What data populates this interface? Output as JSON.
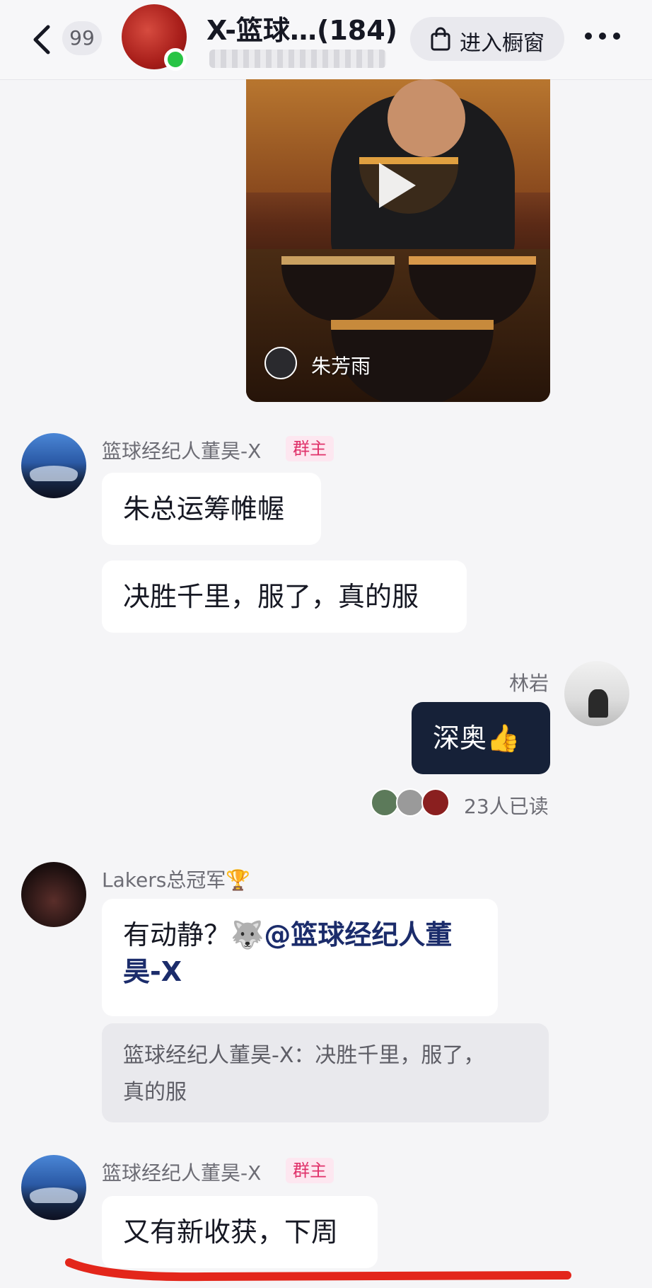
{
  "header": {
    "back_badge": "99",
    "title": "X-篮球…(184)",
    "shop_label": "进入橱窗",
    "colors": {
      "online": "#28c445",
      "background": "#f7f7f9"
    }
  },
  "video": {
    "author": "朱芳雨"
  },
  "messages": [
    {
      "sender": "篮球经纪人董昊-X",
      "role_tag": "群主",
      "bubbles": [
        "朱总运筹帷幄",
        "决胜千里，服了，真的服"
      ]
    },
    {
      "sender": "林岩",
      "text": "深奥",
      "emoji": "👍",
      "read_count": "23人已读"
    },
    {
      "sender": "Lakers总冠军",
      "sender_emoji": "🏆",
      "text_prefix": "有动静？",
      "emoji": "🐺",
      "mention_line1": "@篮球经纪人董",
      "mention_line2": "昊-X",
      "quote_line1": "篮球经纪人董昊-X：决胜千里，服了，",
      "quote_line2": "真的服"
    },
    {
      "sender": "篮球经纪人董昊-X",
      "role_tag": "群主",
      "bubbles": [
        "又有新收获，下周"
      ]
    }
  ],
  "colors": {
    "owner_tag_bg": "#fde7f0",
    "owner_tag_text": "#e0336b",
    "self_bubble": "#162138",
    "mention": "#1b2c6b",
    "annotation_red": "#e3261b"
  }
}
